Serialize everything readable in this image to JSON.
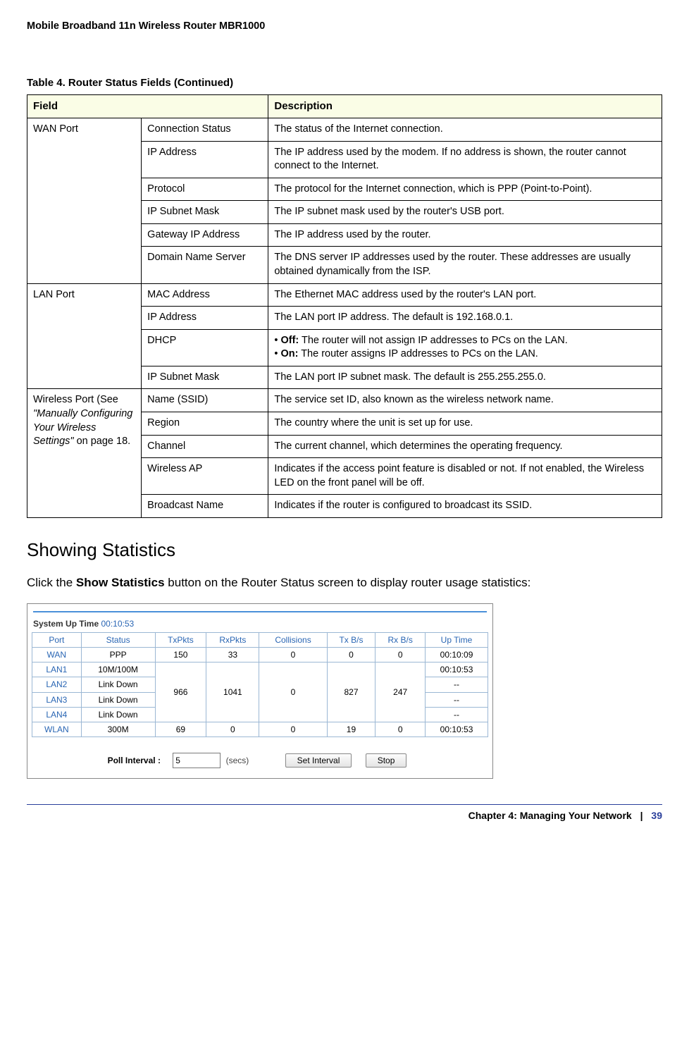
{
  "header": {
    "title": "Mobile Broadband 11n Wireless Router MBR1000"
  },
  "table_caption": "Table 4.  Router Status Fields  (Continued)",
  "col_head": {
    "field": "Field",
    "desc": "Description"
  },
  "wan": {
    "group": "WAN Port",
    "rows": {
      "conn": {
        "sub": "Connection Status",
        "desc": "The status of the Internet connection."
      },
      "ip": {
        "sub": "IP Address",
        "desc": "The IP address used by the modem. If no address is shown, the router cannot connect to the Internet."
      },
      "proto": {
        "sub": "Protocol",
        "desc": "The protocol for the Internet connection, which is PPP (Point-to-Point)."
      },
      "mask": {
        "sub": "IP Subnet Mask",
        "desc": "The IP subnet mask used by the router's USB port."
      },
      "gw": {
        "sub": "Gateway IP Address",
        "desc": "The IP address used by the router."
      },
      "dns": {
        "sub": "Domain Name Server",
        "desc": "The DNS server IP addresses used by the router. These addresses are usually obtained dynamically from the ISP."
      }
    }
  },
  "lan": {
    "group": "LAN Port",
    "rows": {
      "mac": {
        "sub": "MAC Address",
        "desc": "The Ethernet MAC address used by the router's LAN port."
      },
      "ip": {
        "sub": "IP Address",
        "desc": "The LAN port IP address. The default is 192.168.0.1."
      },
      "dhcp": {
        "sub": "DHCP",
        "off_label": "Off:",
        "off_text": " The router will not assign IP addresses to PCs on the LAN.",
        "on_label": "On:",
        "on_text": " The router assigns IP addresses to PCs on the LAN."
      },
      "mask": {
        "sub": "IP Subnet Mask",
        "desc": "The LAN port IP subnet mask. The default is 255.255.255.0."
      }
    }
  },
  "wifi": {
    "group_pre": "Wireless Port (See ",
    "group_ital": "\"Manually Configuring Your Wireless Settings\"",
    "group_post": " on page 18.",
    "rows": {
      "ssid": {
        "sub": "Name (SSID)",
        "desc": "The service set ID, also known as the wireless network name."
      },
      "region": {
        "sub": "Region",
        "desc": "The country where the unit is set up for use."
      },
      "chan": {
        "sub": "Channel",
        "desc": "The current channel, which determines the operating frequency."
      },
      "ap": {
        "sub": "Wireless AP",
        "desc": "Indicates if the access point feature is disabled or not. If not enabled, the Wireless LED on the front panel will be off."
      },
      "bcast": {
        "sub": "Broadcast Name",
        "desc": "Indicates if the router is configured to broadcast its SSID."
      }
    }
  },
  "section": {
    "heading": "Showing Statistics",
    "text_pre": "Click the ",
    "text_bold": "Show Statistics",
    "text_post": " button on the Router Status screen to display router usage statistics:"
  },
  "stats": {
    "sys_label": "System Up Time ",
    "sys_time": "00:10:53",
    "headers": [
      "Port",
      "Status",
      "TxPkts",
      "RxPkts",
      "Collisions",
      "Tx B/s",
      "Rx B/s",
      "Up Time"
    ],
    "wan": {
      "port": "WAN",
      "status": "PPP",
      "tx": "150",
      "rx": "33",
      "col": "0",
      "txbs": "0",
      "rxbs": "0",
      "up": "00:10:09"
    },
    "lan1": {
      "port": "LAN1",
      "status": "10M/100M",
      "up": "00:10:53"
    },
    "lan2": {
      "port": "LAN2",
      "status": "Link Down",
      "up": "--"
    },
    "lan3": {
      "port": "LAN3",
      "status": "Link Down",
      "up": "--"
    },
    "lan4": {
      "port": "LAN4",
      "status": "Link Down",
      "up": "--"
    },
    "lan_agg": {
      "tx": "966",
      "rx": "1041",
      "col": "0",
      "txbs": "827",
      "rxbs": "247"
    },
    "wlan": {
      "port": "WLAN",
      "status": "300M",
      "tx": "69",
      "rx": "0",
      "col": "0",
      "txbs": "19",
      "rxbs": "0",
      "up": "00:10:53"
    },
    "poll": {
      "label": "Poll Interval :",
      "value": "5",
      "unit": "(secs)",
      "set": "Set Interval",
      "stop": "Stop"
    }
  },
  "footer": {
    "chapter": "Chapter 4:  Managing Your Network",
    "page": "39"
  }
}
